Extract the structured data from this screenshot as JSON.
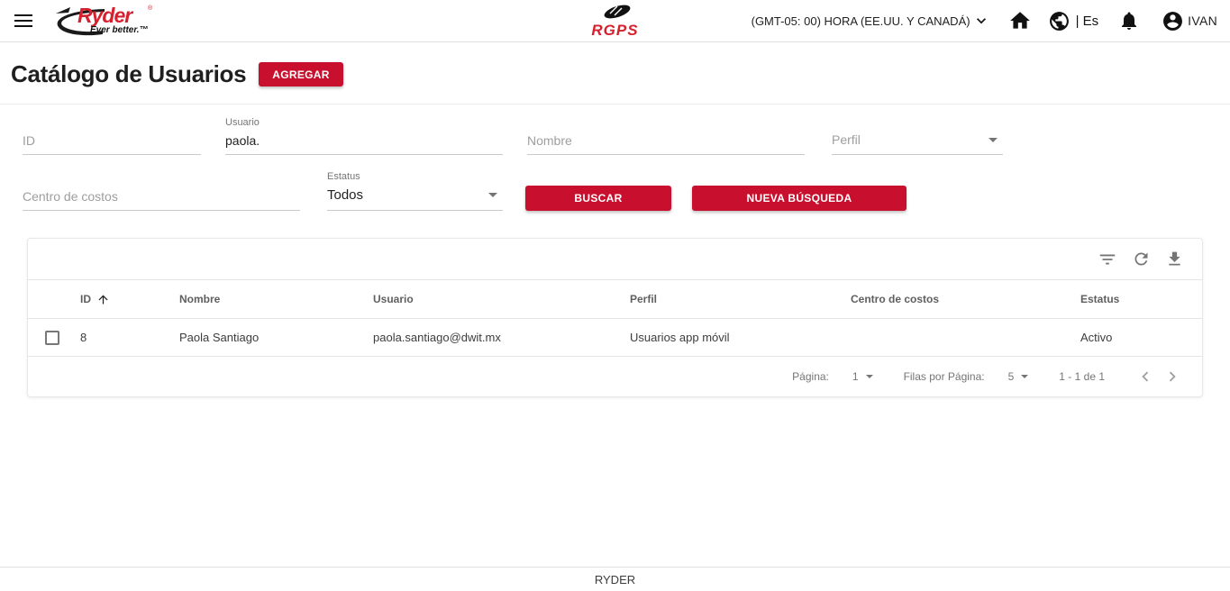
{
  "colors": {
    "brand_red": "#c8102e",
    "border_gray": "#e0e0e0"
  },
  "header": {
    "brand": {
      "name": "Ryder",
      "reg": "®",
      "tagline": "Ever better.™"
    },
    "app_logo": "RGPS",
    "timezone": "(GMT-05: 00) HORA (EE.UU. Y CANADÁ)",
    "language": "| Es",
    "user": "IVAN"
  },
  "page": {
    "title": "Catálogo de Usuarios",
    "add_button": "AGREGAR"
  },
  "filters": {
    "id": {
      "placeholder": "ID"
    },
    "usuario": {
      "label": "Usuario",
      "value": "paola."
    },
    "nombre": {
      "placeholder": "Nombre"
    },
    "perfil": {
      "placeholder": "Perfil"
    },
    "centro_costos": {
      "placeholder": "Centro de costos"
    },
    "estatus": {
      "label": "Estatus",
      "value": "Todos"
    },
    "buscar_button": "BUSCAR",
    "nueva_busqueda_button": "NUEVA BÚSQUEDA"
  },
  "table": {
    "columns": [
      "ID",
      "Nombre",
      "Usuario",
      "Perfil",
      "Centro de costos",
      "Estatus"
    ],
    "rows": [
      {
        "id": "8",
        "nombre": "Paola Santiago",
        "usuario": "paola.santiago@dwit.mx",
        "perfil": "Usuarios app móvil",
        "centro_costos": "",
        "estatus": "Activo"
      }
    ],
    "pagination": {
      "page_label": "Página:",
      "page_value": "1",
      "rows_label": "Filas por Página:",
      "rows_value": "5",
      "range": "1 - 1 de 1"
    }
  },
  "footer": {
    "text": "RYDER"
  }
}
